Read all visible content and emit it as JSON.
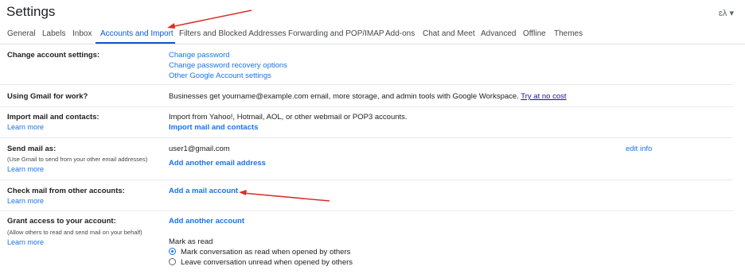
{
  "header": {
    "title": "Settings",
    "language_icon_label": "ɛλ ▾"
  },
  "tabs": [
    {
      "label": "General"
    },
    {
      "label": "Labels"
    },
    {
      "label": "Inbox"
    },
    {
      "label": "Accounts and Import",
      "active": true
    },
    {
      "label": "Filters and Blocked Addresses"
    },
    {
      "label": "Forwarding and POP/IMAP"
    },
    {
      "label": "Add-ons"
    },
    {
      "label": "Chat and Meet"
    },
    {
      "label": "Advanced"
    },
    {
      "label": "Offline"
    },
    {
      "label": "Themes"
    }
  ],
  "sections": {
    "change_account": {
      "label": "Change account settings:",
      "links": [
        "Change password",
        "Change password recovery options",
        "Other Google Account settings"
      ]
    },
    "gmail_for_work": {
      "label": "Using Gmail for work?",
      "text": "Businesses get yourname@example.com email, more storage, and admin tools with Google Workspace.",
      "link": "Try at no cost"
    },
    "import_mail": {
      "label": "Import mail and contacts:",
      "learn_more": "Learn more",
      "text": "Import from Yahoo!, Hotmail, AOL, or other webmail or POP3 accounts.",
      "link": "Import mail and contacts"
    },
    "send_mail_as": {
      "label": "Send mail as:",
      "sublabel": "(Use Gmail to send from your other email addresses)",
      "learn_more": "Learn more",
      "email": "user1@gmail.com",
      "edit": "edit info",
      "add_link": "Add another email address"
    },
    "check_mail": {
      "label": "Check mail from other accounts:",
      "learn_more": "Learn more",
      "link": "Add a mail account"
    },
    "grant_access": {
      "label": "Grant access to your account:",
      "sublabel": "(Allow others to read and send mail on your behalf)",
      "learn_more": "Learn more",
      "link": "Add another account",
      "mark_as_read": "Mark as read",
      "option_read": "Mark conversation as read when opened by others",
      "option_unread": "Leave conversation unread when opened by others"
    }
  },
  "annotation_color": "#d93025"
}
